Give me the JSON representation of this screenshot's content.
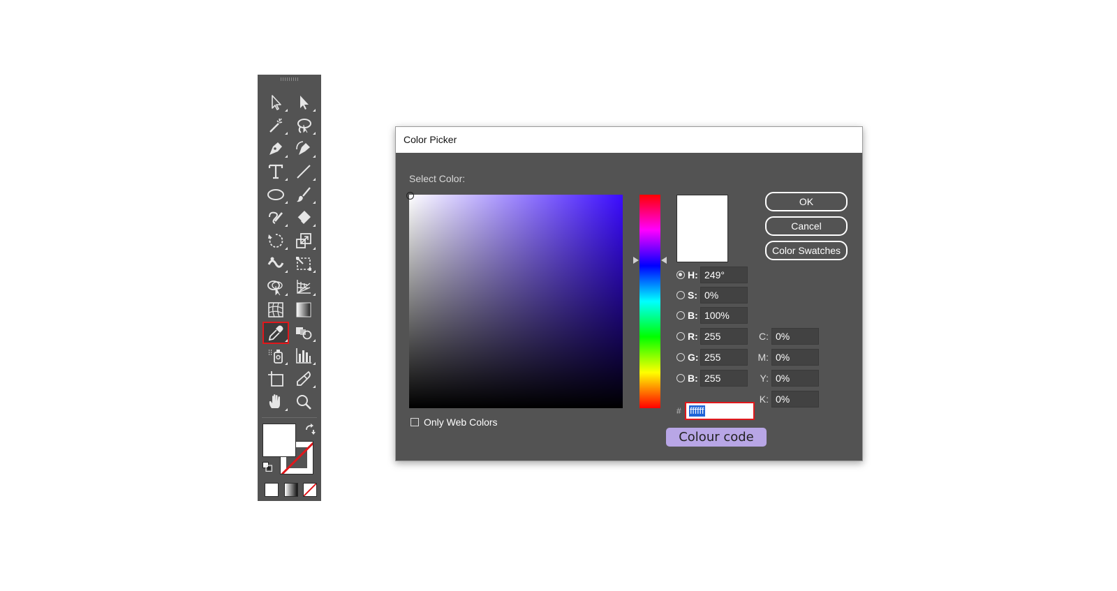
{
  "toolbar": {
    "tools": [
      {
        "name": "selection-tool",
        "icon": "arrow-outline-icon"
      },
      {
        "name": "direct-selection-tool",
        "icon": "arrow-filled-icon"
      },
      {
        "name": "magic-wand-tool",
        "icon": "magic-wand-icon"
      },
      {
        "name": "lasso-tool",
        "icon": "lasso-icon"
      },
      {
        "name": "pen-tool",
        "icon": "pen-icon"
      },
      {
        "name": "curvature-tool",
        "icon": "curvature-pen-icon"
      },
      {
        "name": "type-tool",
        "icon": "type-icon"
      },
      {
        "name": "line-segment-tool",
        "icon": "line-icon"
      },
      {
        "name": "ellipse-tool",
        "icon": "ellipse-icon"
      },
      {
        "name": "paintbrush-tool",
        "icon": "paintbrush-icon"
      },
      {
        "name": "shaper-tool",
        "icon": "shaper-icon"
      },
      {
        "name": "eraser-tool",
        "icon": "eraser-icon"
      },
      {
        "name": "rotate-tool",
        "icon": "rotate-icon"
      },
      {
        "name": "scale-tool",
        "icon": "scale-icon"
      },
      {
        "name": "width-tool",
        "icon": "width-icon"
      },
      {
        "name": "free-transform-tool",
        "icon": "free-transform-icon"
      },
      {
        "name": "shape-builder-tool",
        "icon": "shape-builder-icon"
      },
      {
        "name": "perspective-grid-tool",
        "icon": "perspective-grid-icon"
      },
      {
        "name": "mesh-tool",
        "icon": "mesh-icon"
      },
      {
        "name": "gradient-tool",
        "icon": "gradient-icon"
      },
      {
        "name": "eyedropper-tool",
        "icon": "eyedropper-icon",
        "selected": true
      },
      {
        "name": "blend-tool",
        "icon": "blend-icon"
      },
      {
        "name": "symbol-sprayer-tool",
        "icon": "symbol-sprayer-icon"
      },
      {
        "name": "column-graph-tool",
        "icon": "column-graph-icon"
      },
      {
        "name": "artboard-tool",
        "icon": "artboard-icon"
      },
      {
        "name": "slice-tool",
        "icon": "slice-icon"
      },
      {
        "name": "hand-tool",
        "icon": "hand-icon"
      },
      {
        "name": "zoom-tool",
        "icon": "zoom-icon"
      }
    ],
    "fill_color": "#ffffff",
    "stroke": "none",
    "highlight_color": "#e0181c"
  },
  "dialog": {
    "title": "Color Picker",
    "select_label": "Select Color:",
    "hue_base_color": "#3b0cff",
    "preview_color": "#ffffff",
    "buttons": {
      "ok": "OK",
      "cancel": "Cancel",
      "swatches": "Color Swatches"
    },
    "fields": {
      "h": {
        "label": "H:",
        "value": "249°",
        "selected": true
      },
      "s": {
        "label": "S:",
        "value": "0%"
      },
      "b": {
        "label": "B:",
        "value": "100%"
      },
      "r": {
        "label": "R:",
        "value": "255"
      },
      "g": {
        "label": "G:",
        "value": "255"
      },
      "b2": {
        "label": "B:",
        "value": "255"
      },
      "c": {
        "label": "C:",
        "value": "0%"
      },
      "m": {
        "label": "M:",
        "value": "0%"
      },
      "y": {
        "label": "Y:",
        "value": "0%"
      },
      "k": {
        "label": "K:",
        "value": "0%"
      }
    },
    "hash": "#",
    "hex": "ffffff",
    "web_colors_label": "Only Web Colors",
    "web_colors_checked": false
  },
  "annotation": {
    "text": "Colour code",
    "color": "#b8a6e6"
  }
}
